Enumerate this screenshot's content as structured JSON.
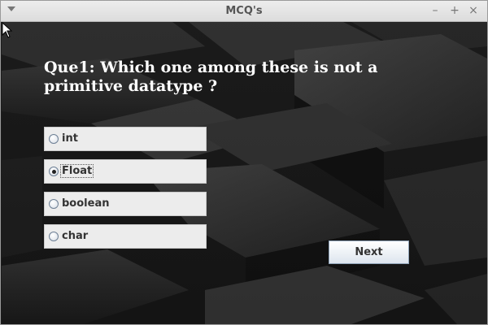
{
  "window": {
    "title": "MCQ's",
    "controls": {
      "minimize": "–",
      "maximize": "+",
      "close": "×"
    }
  },
  "question": {
    "text": "Que1: Which one among these is not a primitive datatype ?"
  },
  "options": [
    {
      "label": "int",
      "selected": false
    },
    {
      "label": "Float",
      "selected": true
    },
    {
      "label": "boolean",
      "selected": false
    },
    {
      "label": "char",
      "selected": false
    }
  ],
  "next_button": {
    "label": "Next"
  }
}
